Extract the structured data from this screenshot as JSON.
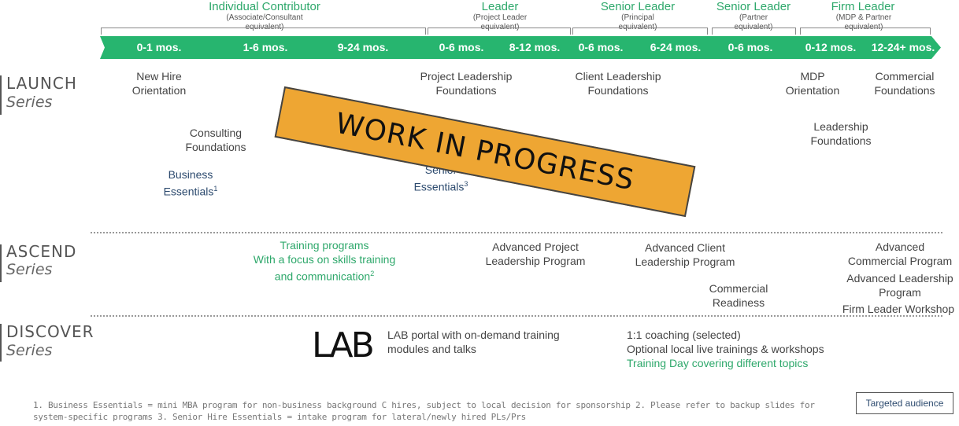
{
  "header": {
    "roles": [
      {
        "title": "Individual Contributor",
        "sub": "(Associate/Consultant equivalent)"
      },
      {
        "title": "Leader",
        "sub": "(Project Leader equivalent)"
      },
      {
        "title": "Senior Leader",
        "sub": "(Principal equivalent)"
      },
      {
        "title": "Senior Leader",
        "sub": "(Partner equivalent)"
      },
      {
        "title": "Firm Leader",
        "sub": "(MDP & Partner equivalent)"
      }
    ],
    "periods": [
      "0-1 mos.",
      "1-6 mos.",
      "9-24 mos.",
      "0-6 mos.",
      "8-12 mos.",
      "0-6 mos.",
      "6-24 mos.",
      "0-6 mos.",
      "0-12 mos.",
      "12-24+ mos."
    ]
  },
  "series": {
    "launch": {
      "name": "LAUNCH",
      "sub": "Series"
    },
    "ascend": {
      "name": "ASCEND",
      "sub": "Series"
    },
    "discover": {
      "name": "DISCOVER",
      "sub": "Series"
    }
  },
  "launch": {
    "new_hire": [
      "New Hire",
      "Orientation"
    ],
    "consulting": [
      "Consulting",
      "Foundations"
    ],
    "business": [
      "Business",
      "Essentials"
    ],
    "business_sup": "1",
    "pl_foundations": [
      "Project Leadership",
      "Foundations"
    ],
    "senior_hire": [
      "Senior",
      "Essentials"
    ],
    "senior_sup": "3",
    "client_foundations": [
      "Client Leadership",
      "Foundations"
    ],
    "mdp": [
      "MDP",
      "Orientation"
    ],
    "leadership_foundations": [
      "Leadership",
      "Foundations"
    ],
    "commercial_foundations": [
      "Commercial",
      "Foundations"
    ]
  },
  "wip": "WORK IN PROGRESS",
  "ascend": {
    "training": [
      "Training programs",
      "With a focus on skills training",
      "and communication"
    ],
    "training_sup": "2",
    "adv_project": [
      "Advanced Project",
      "Leadership Program"
    ],
    "adv_client": [
      "Advanced Client",
      "Leadership Program"
    ],
    "commercial_readiness": [
      "Commercial",
      "Readiness"
    ],
    "adv_commercial": [
      "Advanced",
      "Commercial Program"
    ],
    "adv_leadership": [
      "Advanced Leadership",
      "Program"
    ],
    "firm_leader_workshop": "Firm Leader Workshop"
  },
  "discover": {
    "lab_logo": "LAB",
    "lab_portal": [
      "LAB portal with on-demand training",
      "modules and talks"
    ],
    "coaching": "1:1 coaching (selected)",
    "optional": "Optional local live trainings & workshops",
    "training_day": "Training Day covering different topics"
  },
  "footnote": [
    "1. Business Essentials = mini MBA program for non-business background C hires, subject to local decision for sponsorship 2. Please refer to backup slides for",
    "system-specific programs 3. Senior Hire Essentials = intake program for lateral/newly  hired PLs/Prs"
  ],
  "legend": "Targeted audience",
  "colors": {
    "accent_green": "#27b56f",
    "wip_orange": "#eea633",
    "navy": "#2c4a6e"
  }
}
